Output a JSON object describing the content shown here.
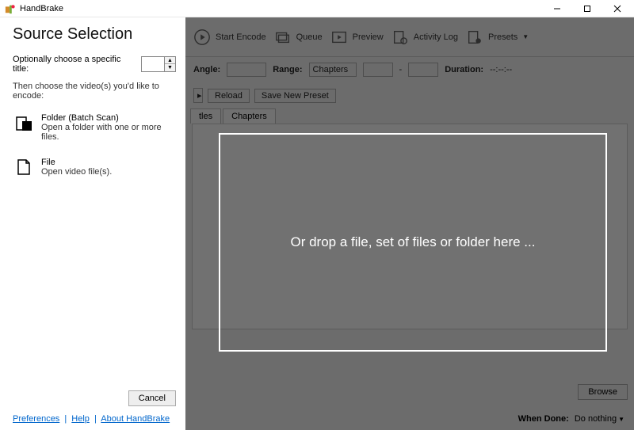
{
  "titlebar": {
    "app_name": "HandBrake"
  },
  "sidebar": {
    "title": "Source Selection",
    "title_prompt": "Optionally choose a specific title:",
    "title_value": "",
    "sub_prompt": "Then choose the video(s) you'd like to encode:",
    "folder": {
      "label": "Folder (Batch Scan)",
      "desc": "Open a folder with one or more files."
    },
    "file": {
      "label": "File",
      "desc": "Open video file(s)."
    },
    "cancel": "Cancel",
    "links": {
      "preferences": "Preferences",
      "help": "Help",
      "about": "About HandBrake"
    }
  },
  "dropzone": {
    "text": "Or drop a file, set of files or folder here ..."
  },
  "bg": {
    "toolbar": {
      "start_encode": "Start Encode",
      "queue": "Queue",
      "preview": "Preview",
      "activity_log": "Activity Log",
      "presets": "Presets"
    },
    "row1": {
      "angle": "Angle:",
      "range": "Range:",
      "range_value": "Chapters",
      "sep": "-",
      "duration": "Duration:",
      "duration_value": "--:--:--"
    },
    "btns": {
      "reload": "Reload",
      "save": "Save New Preset"
    },
    "tabs": {
      "subtitles": "tles",
      "chapters": "Chapters"
    },
    "browse": "Browse",
    "when_done": "When Done:",
    "when_done_value": "Do nothing"
  }
}
